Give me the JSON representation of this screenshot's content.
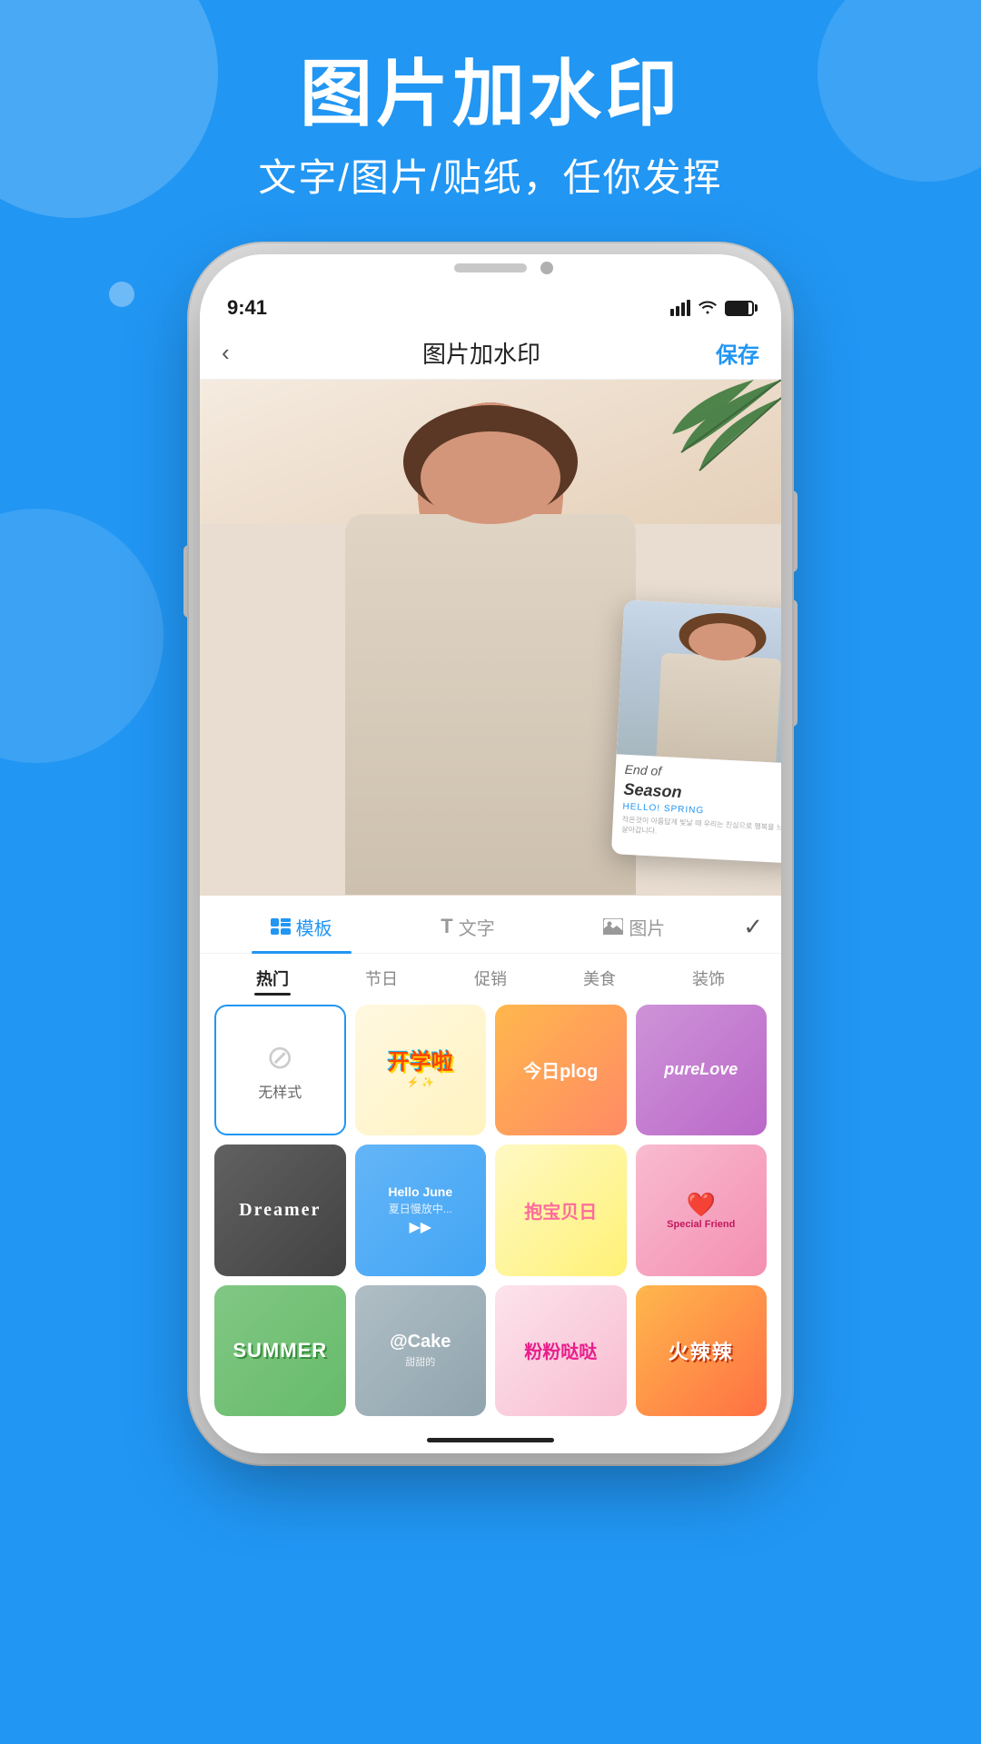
{
  "app": {
    "background_color": "#2196F3"
  },
  "header": {
    "title": "图片加水印",
    "subtitle": "文字/图片/贴纸，任你发挥"
  },
  "status_bar": {
    "time": "9:41",
    "signal": "••••",
    "wifi": "wifi",
    "battery": "battery"
  },
  "navbar": {
    "back_icon": "‹",
    "title": "图片加水印",
    "save_label": "保存"
  },
  "floating_card": {
    "line1": "End of",
    "line2": "Season",
    "line3": "HELLO! SPRING",
    "line4": "작은것이 아름답게 빛날 때 우리는 진심으로 행복을 느끼며 살아갑니다."
  },
  "tabs": [
    {
      "id": "template",
      "icon": "⊞",
      "label": "模板",
      "active": true
    },
    {
      "id": "text",
      "icon": "T",
      "label": "文字",
      "active": false
    },
    {
      "id": "image",
      "icon": "🖼",
      "label": "图片",
      "active": false
    }
  ],
  "check_icon": "✓",
  "categories": [
    {
      "id": "hot",
      "label": "热门",
      "active": true
    },
    {
      "id": "holiday",
      "label": "节日",
      "active": false
    },
    {
      "id": "promo",
      "label": "促销",
      "active": false
    },
    {
      "id": "food",
      "label": "美食",
      "active": false
    },
    {
      "id": "decor",
      "label": "装饰",
      "active": false
    }
  ],
  "stickers": [
    {
      "id": "no-style",
      "type": "no-style",
      "label": "无样式"
    },
    {
      "id": "kaixin",
      "type": "kaixin",
      "label": "开学啦",
      "color": "#FFD700"
    },
    {
      "id": "plog",
      "type": "plog",
      "label": "今日plog",
      "color": "#fff"
    },
    {
      "id": "love",
      "type": "love",
      "label": "pureLove",
      "color": "#fff"
    },
    {
      "id": "dreamer",
      "type": "dreamer",
      "label": "Dreamer",
      "color": "#fff"
    },
    {
      "id": "hello",
      "type": "hello",
      "label": "Hello June 夏日慢放中...",
      "color": "#fff"
    },
    {
      "id": "baobei",
      "type": "baobei",
      "label": "抱宝贝日",
      "color": "#ff6b9d"
    },
    {
      "id": "special",
      "type": "special",
      "label": "Special Friend",
      "color": "#d63384"
    },
    {
      "id": "summer",
      "type": "summer",
      "label": "SUMMER",
      "color": "#fff"
    },
    {
      "id": "cake",
      "type": "cake",
      "label": "@Cake",
      "color": "#fff"
    },
    {
      "id": "pink",
      "type": "pink",
      "label": "粉粉哒哒",
      "color": "#ff69b4"
    },
    {
      "id": "hot",
      "type": "hot",
      "label": "火辣辣",
      "color": "#fff"
    }
  ]
}
